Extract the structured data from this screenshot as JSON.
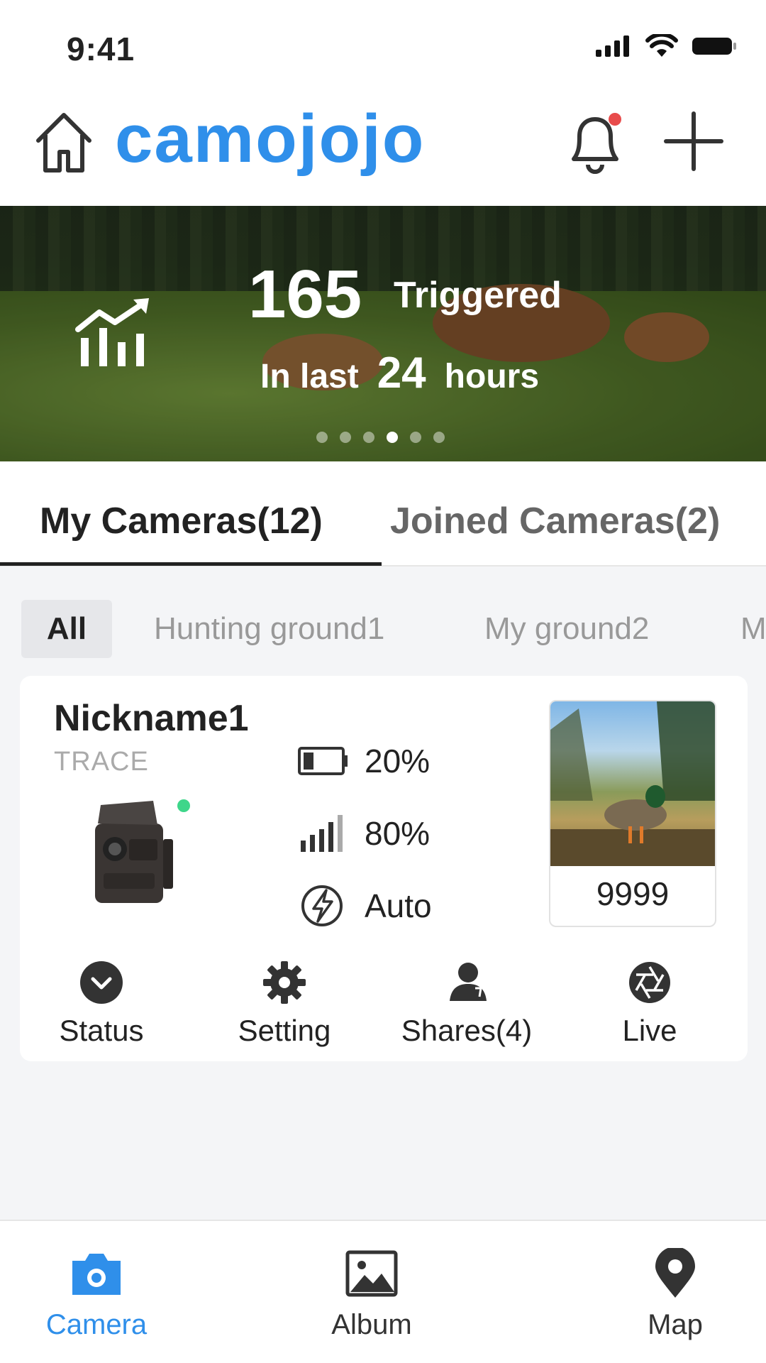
{
  "status_bar": {
    "time": "9:41"
  },
  "header": {
    "brand": "camojojo"
  },
  "banner": {
    "count": "165",
    "count_label": "Triggered",
    "line2_prefix": "In last",
    "line2_value": "24",
    "line2_suffix": "hours",
    "page_count": 6,
    "active_page": 4
  },
  "tabs": [
    {
      "label": "My Cameras(12)",
      "active": true
    },
    {
      "label": "Joined Cameras(2)",
      "active": false
    }
  ],
  "groups": [
    {
      "label": "All",
      "active": true
    },
    {
      "label": "Hunting ground1",
      "active": false
    },
    {
      "label": "My ground2",
      "active": false
    },
    {
      "label": "M",
      "active": false
    }
  ],
  "camera": {
    "nickname": "Nickname1",
    "model": "TRACE",
    "online": true,
    "battery": "20%",
    "signal": "80%",
    "flash_mode": "Auto",
    "photo_count": "9999",
    "actions": [
      {
        "label": "Status",
        "icon": "status-chevron-icon"
      },
      {
        "label": "Setting",
        "icon": "gear-icon"
      },
      {
        "label": "Shares(4)",
        "icon": "person-icon"
      },
      {
        "label": "Live",
        "icon": "aperture-icon"
      }
    ]
  },
  "bottom_nav": [
    {
      "label": "Camera",
      "icon": "camera-icon",
      "active": true
    },
    {
      "label": "Album",
      "icon": "image-icon",
      "active": false
    },
    {
      "label": "Map",
      "icon": "map-pin-icon",
      "active": false
    }
  ],
  "colors": {
    "brand": "#2f8fea",
    "online": "#3ed68a",
    "notification": "#e84b4b"
  }
}
